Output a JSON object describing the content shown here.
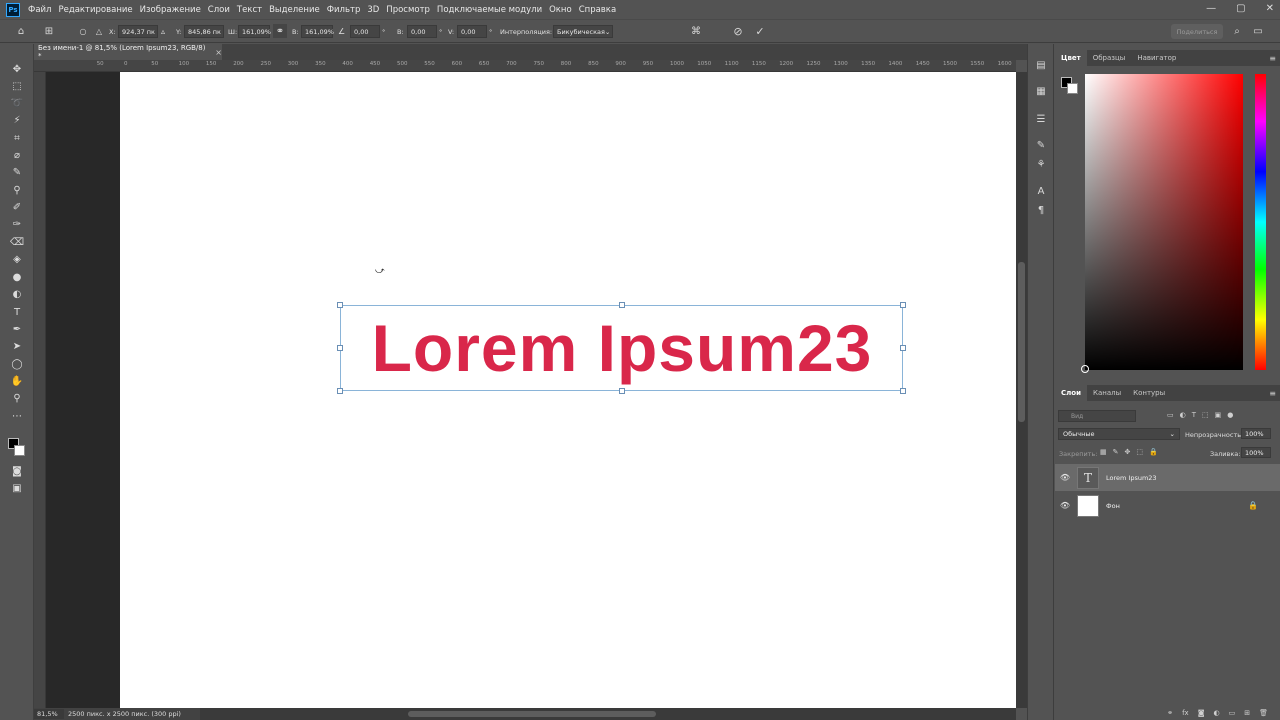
{
  "app": {
    "logo": "Ps"
  },
  "menu": [
    "Файл",
    "Редактирование",
    "Изображение",
    "Слои",
    "Текст",
    "Выделение",
    "Фильтр",
    "3D",
    "Просмотр",
    "Подключаемые модули",
    "Окно",
    "Справка"
  ],
  "window_controls": {
    "minimize": "—",
    "maximize": "▢",
    "close": "✕"
  },
  "options": {
    "x_label": "X:",
    "x_value": "924,37 пк",
    "y_label": "Y:",
    "y_value": "845,86 пк",
    "w_label": "Ш:",
    "w_value": "161,09%",
    "h_label": "В:",
    "h_value": "161,09%",
    "angle_value": "0,00",
    "angle_unit": "°",
    "hskew_label": "В:",
    "hskew_value": "0,00",
    "vskew_label": "V:",
    "vskew_value": "0,00",
    "interp_label": "Интерполяция:",
    "interp_value": "Бикубическая",
    "share": "Поделиться"
  },
  "document": {
    "tab_title": "Без имени-1 @ 81,5% (Lorem Ipsum23, RGB/8) *",
    "close": "×",
    "canvas_text": "Lorem Ipsum23",
    "text_color": "#d9274a"
  },
  "ruler_ticks": [
    "50",
    "0",
    "50",
    "100",
    "150",
    "200",
    "250",
    "300",
    "350",
    "400",
    "450",
    "500",
    "550",
    "600",
    "650",
    "700",
    "750",
    "800",
    "850",
    "900",
    "950",
    "1000",
    "1050",
    "1100",
    "1150",
    "1200",
    "1250",
    "1300",
    "1350",
    "1400",
    "1450",
    "1500",
    "1550",
    "1600",
    "1650"
  ],
  "status": {
    "zoom": "81,5%",
    "doc_info": "2500 пикс. x 2500 пикс. (300 ppi)"
  },
  "color_panel": {
    "tabs": [
      "Цвет",
      "Образцы",
      "Навигатор"
    ],
    "fg_color": "#000000",
    "bg_color": "#ffffff"
  },
  "layers_panel": {
    "tabs": [
      "Слои",
      "Каналы",
      "Контуры"
    ],
    "search_placeholder": "Вид",
    "blend_mode": "Обычные",
    "opacity_label": "Непрозрачность:",
    "opacity_value": "100%",
    "lock_label": "Закрепить:",
    "fill_label": "Заливка:",
    "fill_value": "100%",
    "layers": [
      {
        "name": "Lorem Ipsum23",
        "type": "text",
        "thumb_glyph": "T"
      },
      {
        "name": "Фон",
        "type": "background"
      }
    ]
  }
}
